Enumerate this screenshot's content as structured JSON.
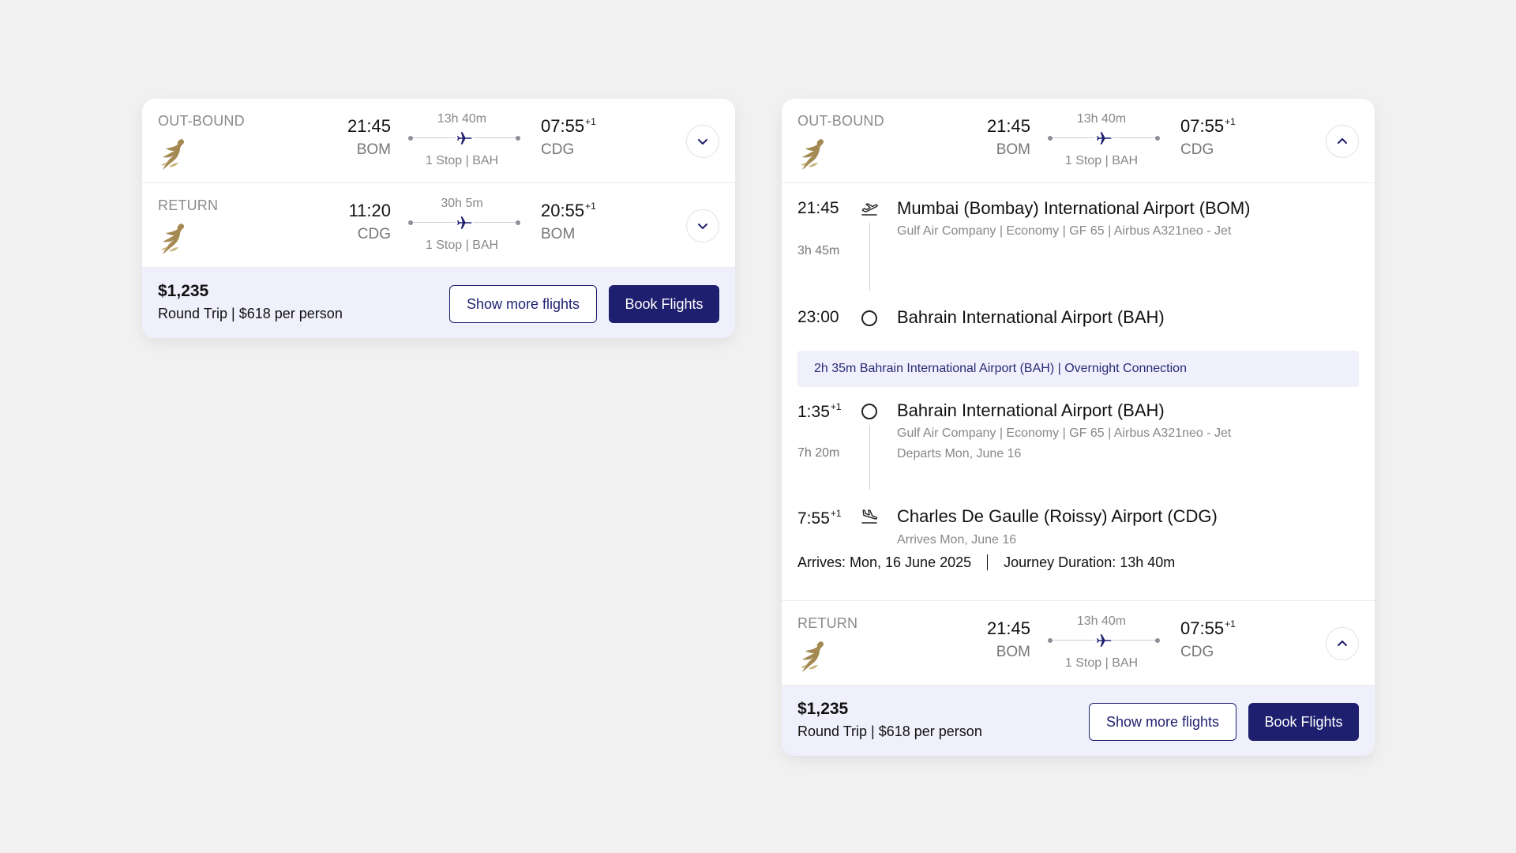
{
  "compact": {
    "outbound": {
      "label": "OUT-BOUND",
      "dep_time": "21:45",
      "dep_code": "BOM",
      "duration": "13h 40m",
      "stops": "1 Stop | BAH",
      "arr_time": "07:55",
      "arr_sup": "+1",
      "arr_code": "CDG",
      "toggle_icon": "chevron-down-icon"
    },
    "return": {
      "label": "RETURN",
      "dep_time": "11:20",
      "dep_code": "CDG",
      "duration": "30h 5m",
      "stops": "1 Stop | BAH",
      "arr_time": "20:55",
      "arr_sup": "+1",
      "arr_code": "BOM",
      "toggle_icon": "chevron-down-icon"
    },
    "footer": {
      "price": "$1,235",
      "price_sub": "Round Trip | $618 per person",
      "more_label": "Show more flights",
      "book_label": "Book Flights"
    }
  },
  "expanded": {
    "outbound": {
      "label": "OUT-BOUND",
      "dep_time": "21:45",
      "dep_code": "BOM",
      "duration": "13h 40m",
      "stops": "1 Stop | BAH",
      "arr_time": "07:55",
      "arr_sup": "+1",
      "arr_code": "CDG",
      "toggle_icon": "chevron-up-icon"
    },
    "detail": {
      "seg1": {
        "dep_time": "21:45",
        "dep_airport": "Mumbai (Bombay) International Airport (BOM)",
        "info": "Gulf Air Company | Economy | GF 65 | Airbus A321neo - Jet",
        "duration": "3h 45m",
        "arr_time": "23:00",
        "arr_airport": "Bahrain International Airport (BAH)"
      },
      "layover": "2h 35m Bahrain International Airport (BAH) | Overnight Connection",
      "seg2": {
        "dep_time": "1:35",
        "dep_sup": "+1",
        "dep_airport": "Bahrain International Airport (BAH)",
        "info": "Gulf Air Company | Economy | GF 65 | Airbus A321neo - Jet",
        "departs": "Departs Mon, June 16",
        "duration": "7h 20m",
        "arr_time": "7:55",
        "arr_sup": "+1",
        "arr_airport": "Charles De Gaulle (Roissy) Airport (CDG)",
        "arrives": "Arrives Mon, June 16"
      },
      "arrives_summary": "Arrives: Mon, 16 June 2025",
      "journey_summary": "Journey Duration: 13h 40m"
    },
    "return": {
      "label": "RETURN",
      "dep_time": "21:45",
      "dep_code": "BOM",
      "duration": "13h 40m",
      "stops": "1 Stop | BAH",
      "arr_time": "07:55",
      "arr_sup": "+1",
      "arr_code": "CDG",
      "toggle_icon": "chevron-up-icon"
    },
    "footer": {
      "price": "$1,235",
      "price_sub": "Round Trip | $618 per person",
      "more_label": "Show more flights",
      "book_label": "Book Flights"
    }
  },
  "colors": {
    "brand_navy": "#1e1f6f",
    "footer_tint": "#eff0fb",
    "logo_gold": "#a48a52"
  }
}
